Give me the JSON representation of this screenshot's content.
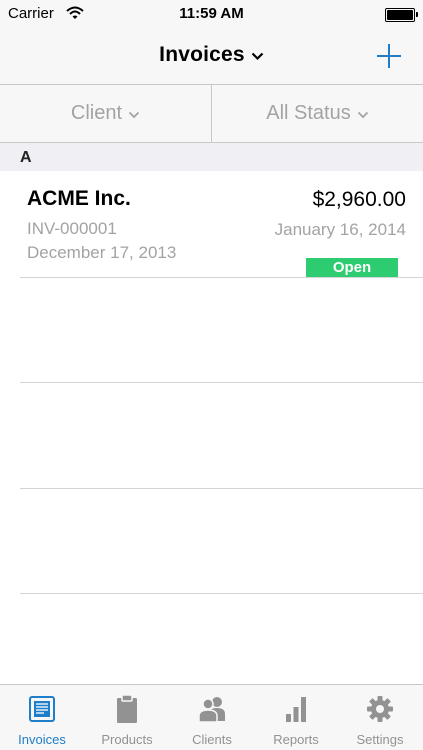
{
  "status_bar": {
    "carrier": "Carrier",
    "time": "11:59 AM",
    "wifi_icon": "wifi-icon",
    "battery_icon": "battery-icon"
  },
  "nav": {
    "title": "Invoices",
    "title_icon": "chevron-down-icon",
    "add_icon": "plus-icon"
  },
  "filters": {
    "client_label": "Client",
    "status_label": "All Status"
  },
  "sections": [
    {
      "letter": "A",
      "invoices": [
        {
          "client": "ACME Inc.",
          "number": "INV-000001",
          "date": "December 17, 2013",
          "amount": "$2,960.00",
          "due_date": "January 16, 2014",
          "status": "Open",
          "status_color": "#2ecc71"
        }
      ]
    }
  ],
  "tabs": [
    {
      "label": "Invoices",
      "icon": "invoice-icon",
      "active": true
    },
    {
      "label": "Products",
      "icon": "clipboard-icon",
      "active": false
    },
    {
      "label": "Clients",
      "icon": "people-icon",
      "active": false
    },
    {
      "label": "Reports",
      "icon": "bar-chart-icon",
      "active": false
    },
    {
      "label": "Settings",
      "icon": "gear-icon",
      "active": false
    }
  ],
  "colors": {
    "accent": "#1f7ec9",
    "inactive": "#929292",
    "muted_text": "#a3a3a3",
    "open_badge": "#2ecc71"
  }
}
